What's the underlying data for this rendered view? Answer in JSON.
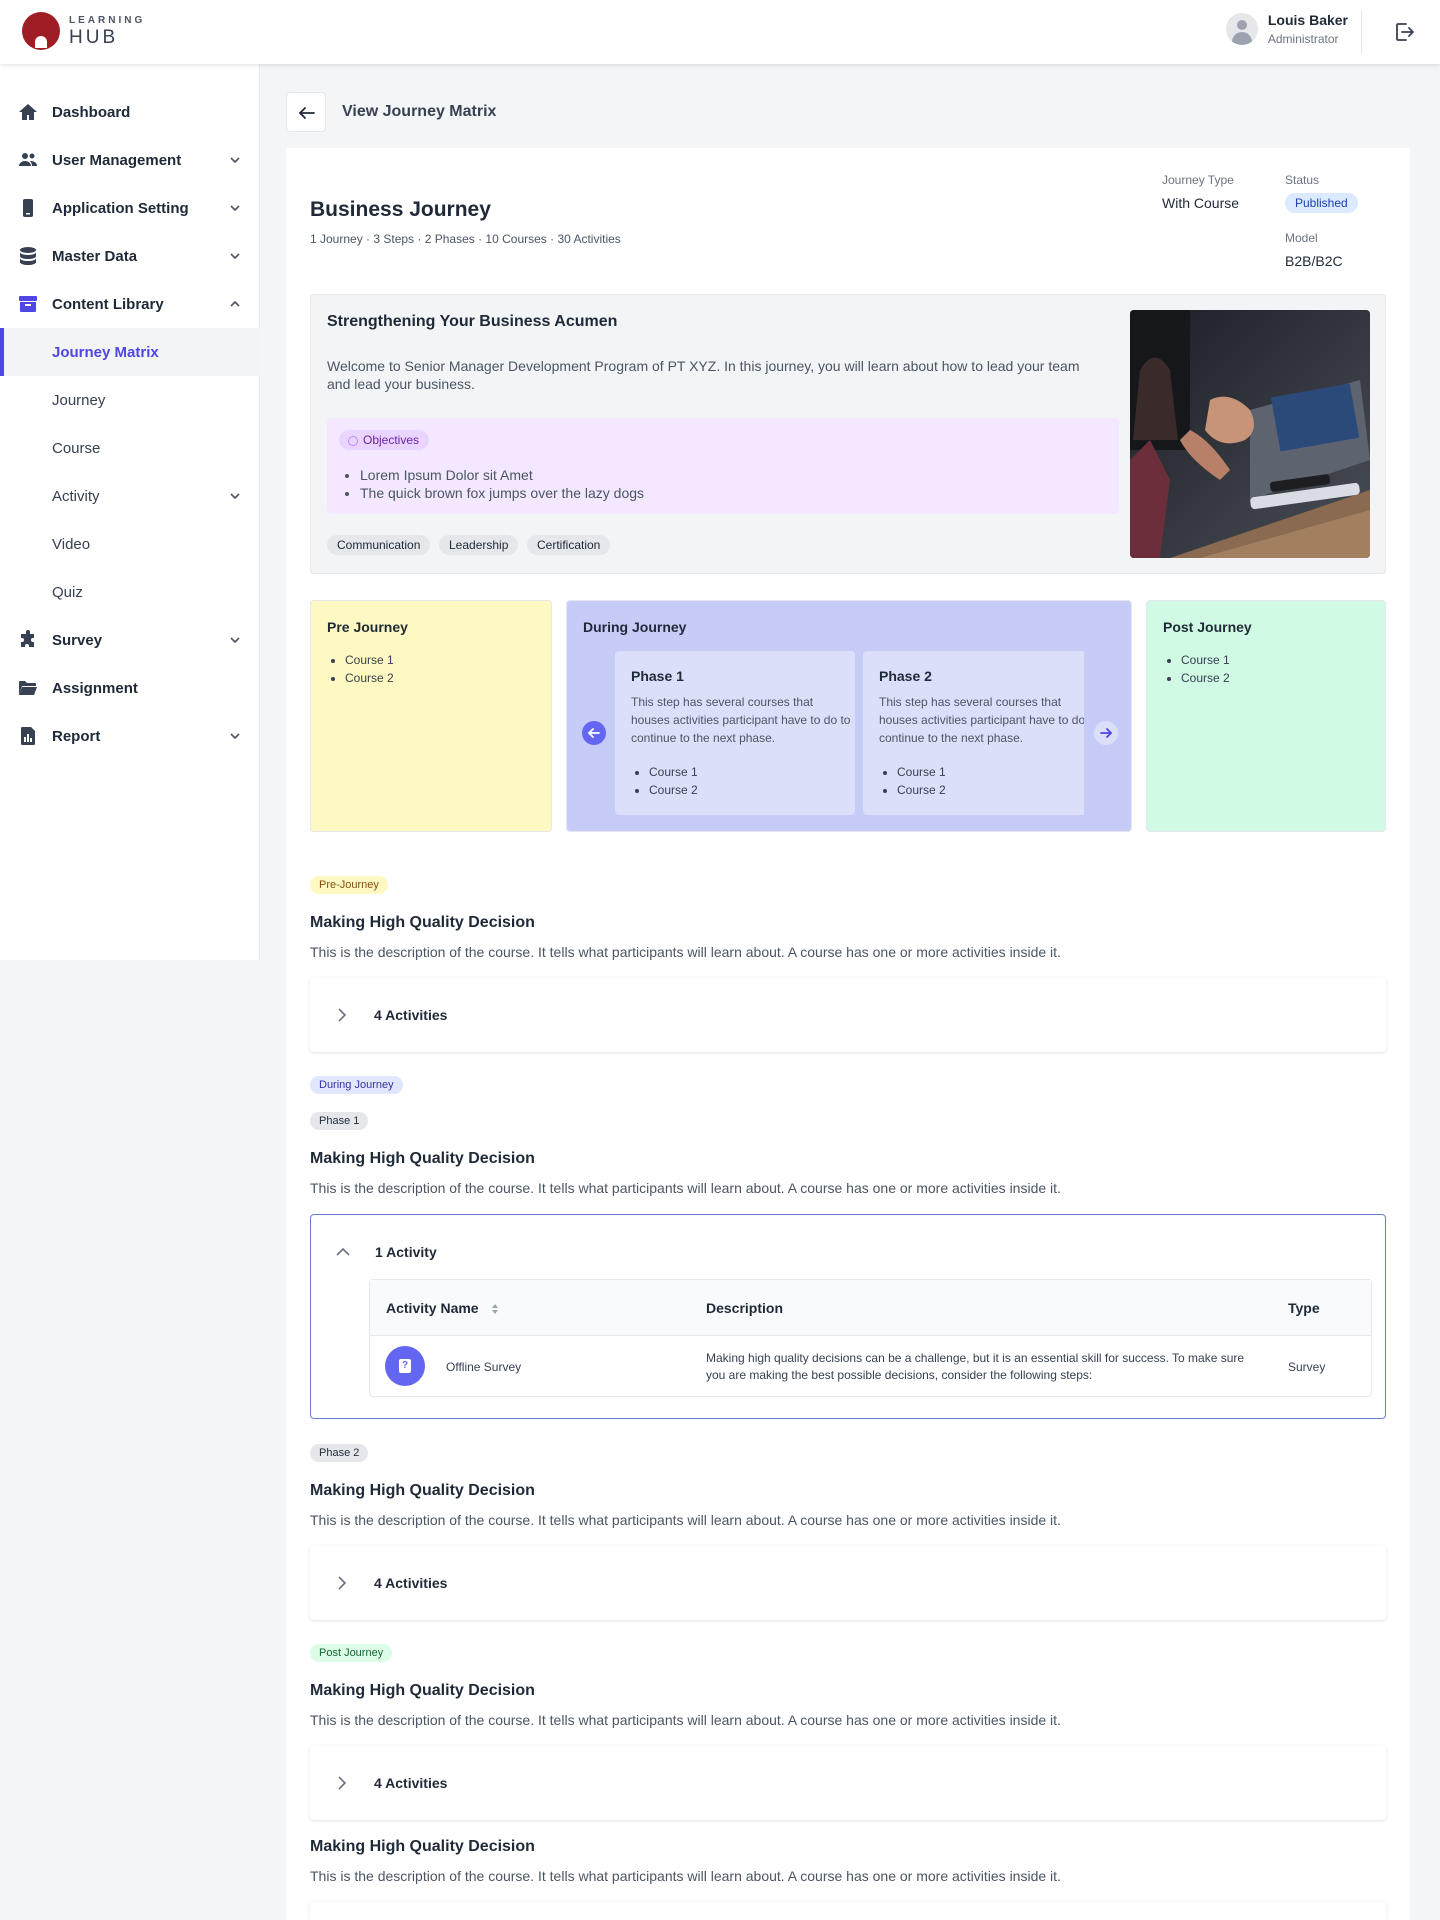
{
  "app": {
    "logo_small": "LEARNING",
    "logo_big": "HUB",
    "user_name": "Louis Baker",
    "user_role": "Administrator"
  },
  "sidebar": {
    "items": [
      {
        "label": "Dashboard",
        "icon": "home-icon"
      },
      {
        "label": "User Management",
        "icon": "users-icon"
      },
      {
        "label": "Application Setting",
        "icon": "mobile-icon"
      },
      {
        "label": "Master Data",
        "icon": "database-icon"
      },
      {
        "label": "Content Library",
        "icon": "archive-icon"
      },
      {
        "label": "Journey Matrix"
      },
      {
        "label": "Journey"
      },
      {
        "label": "Course"
      },
      {
        "label": "Activity"
      },
      {
        "label": "Video"
      },
      {
        "label": "Quiz"
      },
      {
        "label": "Survey",
        "icon": "puzzle-icon"
      },
      {
        "label": "Assignment",
        "icon": "folder-icon"
      },
      {
        "label": "Report",
        "icon": "report-icon"
      }
    ],
    "active": "Journey Matrix"
  },
  "page": {
    "title": "View Journey Matrix"
  },
  "journey": {
    "title": "Business Journey",
    "subtitle": "1 Journey · 3 Steps · 2 Phases · 10 Courses · 30 Activities",
    "type_label": "Journey Type",
    "type_value": "With Course",
    "status_label": "Status",
    "status_value": "Published",
    "model_label": "Model",
    "model_value": "B2B/B2C"
  },
  "summary": {
    "title": "Strengthening Your Business Acumen",
    "description": "Welcome to Senior Manager Development Program of PT XYZ. In this journey, you will learn about how to lead your team and lead your business.",
    "objectives_label": "Objectives",
    "objectives": [
      "Lorem Ipsum Dolor sit Amet",
      "The quick brown fox jumps over the lazy dogs"
    ],
    "tags": [
      "Communication",
      "Leadership",
      "Certification"
    ]
  },
  "stages": {
    "pre": {
      "title": "Pre Journey",
      "courses": [
        "Course 1",
        "Course 2"
      ]
    },
    "during": {
      "title": "During Journey",
      "phases": [
        {
          "title": "Phase 1",
          "description": "This step has several courses that houses activities participant have to do to continue to the next phase.",
          "courses": [
            "Course 1",
            "Course 2"
          ]
        },
        {
          "title": "Phase 2",
          "description": "This step has several courses that houses activities participant have to do to continue to the next phase.",
          "courses": [
            "Course 1",
            "Course 2"
          ]
        }
      ]
    },
    "post": {
      "title": "Post Journey",
      "courses": [
        "Course 1",
        "Course 2"
      ]
    }
  },
  "sections": {
    "pre_badge": "Pre-Journey",
    "during_badge": "During Journey",
    "phase1_badge": "Phase 1",
    "phase2_badge": "Phase 2",
    "post_badge": "Post Journey",
    "course_title": "Making High Quality Decision",
    "course_desc": "This is the description of the course. It tells what participants will learn about. A course has one or more activities inside it.",
    "activities_4": "4 Activities",
    "activities_1": "1 Activity"
  },
  "table": {
    "headers": [
      "Activity Name",
      "Description",
      "Type"
    ],
    "rows": [
      {
        "name": "Offline Survey",
        "description": "Making high quality decisions can be a challenge, but it is an essential skill for success. To make sure you are making the best possible decisions, consider the following steps:",
        "type": "Survey"
      }
    ]
  },
  "colors": {
    "accent": "#4f46e5",
    "pre": "#fef9c3",
    "during": "#c7cbf8",
    "post": "#d1fae5",
    "objectives_bg": "#f3e8ff"
  }
}
